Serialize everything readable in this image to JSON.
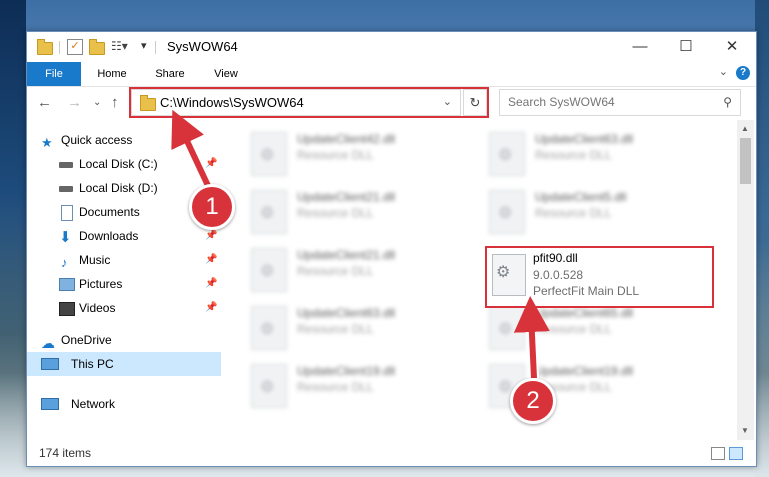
{
  "window": {
    "title": "SysWOW64",
    "controls": {
      "minimize": "—",
      "maximize": "☐",
      "close": "✕"
    }
  },
  "ribbon": {
    "tabs": [
      {
        "label": "File"
      },
      {
        "label": "Home"
      },
      {
        "label": "Share"
      },
      {
        "label": "View"
      }
    ],
    "help_glyph": "?"
  },
  "navigation": {
    "address_path": "C:\\Windows\\SysWOW64",
    "search_placeholder": "Search SysWOW64"
  },
  "sidebar": {
    "items": [
      {
        "label": "Quick access",
        "icon": "star-icon"
      },
      {
        "label": "Local Disk (C:)",
        "icon": "drive-icon",
        "pinned": true
      },
      {
        "label": "Local Disk (D:)",
        "icon": "drive-icon"
      },
      {
        "label": "Documents",
        "icon": "documents-icon",
        "pinned": true
      },
      {
        "label": "Downloads",
        "icon": "download-icon",
        "pinned": true
      },
      {
        "label": "Music",
        "icon": "music-icon",
        "pinned": true
      },
      {
        "label": "Pictures",
        "icon": "pictures-icon",
        "pinned": true
      },
      {
        "label": "Videos",
        "icon": "videos-icon",
        "pinned": true
      },
      {
        "label": "OneDrive",
        "icon": "cloud-icon"
      },
      {
        "label": "This PC",
        "icon": "pc-icon",
        "selected": true
      },
      {
        "label": "Network",
        "icon": "network-icon"
      }
    ]
  },
  "files": [
    {
      "name": "UpdateClient42.dll",
      "desc": "Resource DLL"
    },
    {
      "name": "UpdateClient63.dll",
      "desc": "Resource DLL"
    },
    {
      "name": "UpdateClient21.dll",
      "desc": "Resource DLL"
    },
    {
      "name": "UpdateClient5.dll",
      "desc": "Resource DLL"
    },
    {
      "name": "UpdateClient21.dll",
      "desc": "Resource DLL"
    },
    {
      "name": "UpdateClient63.dll",
      "desc": "Resource DLL"
    },
    {
      "name": "UpdateClient65.dll",
      "desc": "Resource DLL"
    },
    {
      "name": "UpdateClient19.dll",
      "desc": "Resource DLL"
    },
    {
      "name": "UpdateClient19.dll",
      "desc": "Resource DLL"
    }
  ],
  "highlighted_file": {
    "name": "pfit90.dll",
    "version": "9.0.0.528",
    "description": "PerfectFit Main DLL"
  },
  "status": {
    "item_count": "174 items"
  },
  "callouts": {
    "one": "1",
    "two": "2"
  },
  "colors": {
    "accent": "#1979ca",
    "highlight": "#d9313a",
    "selected": "#cce8ff"
  }
}
